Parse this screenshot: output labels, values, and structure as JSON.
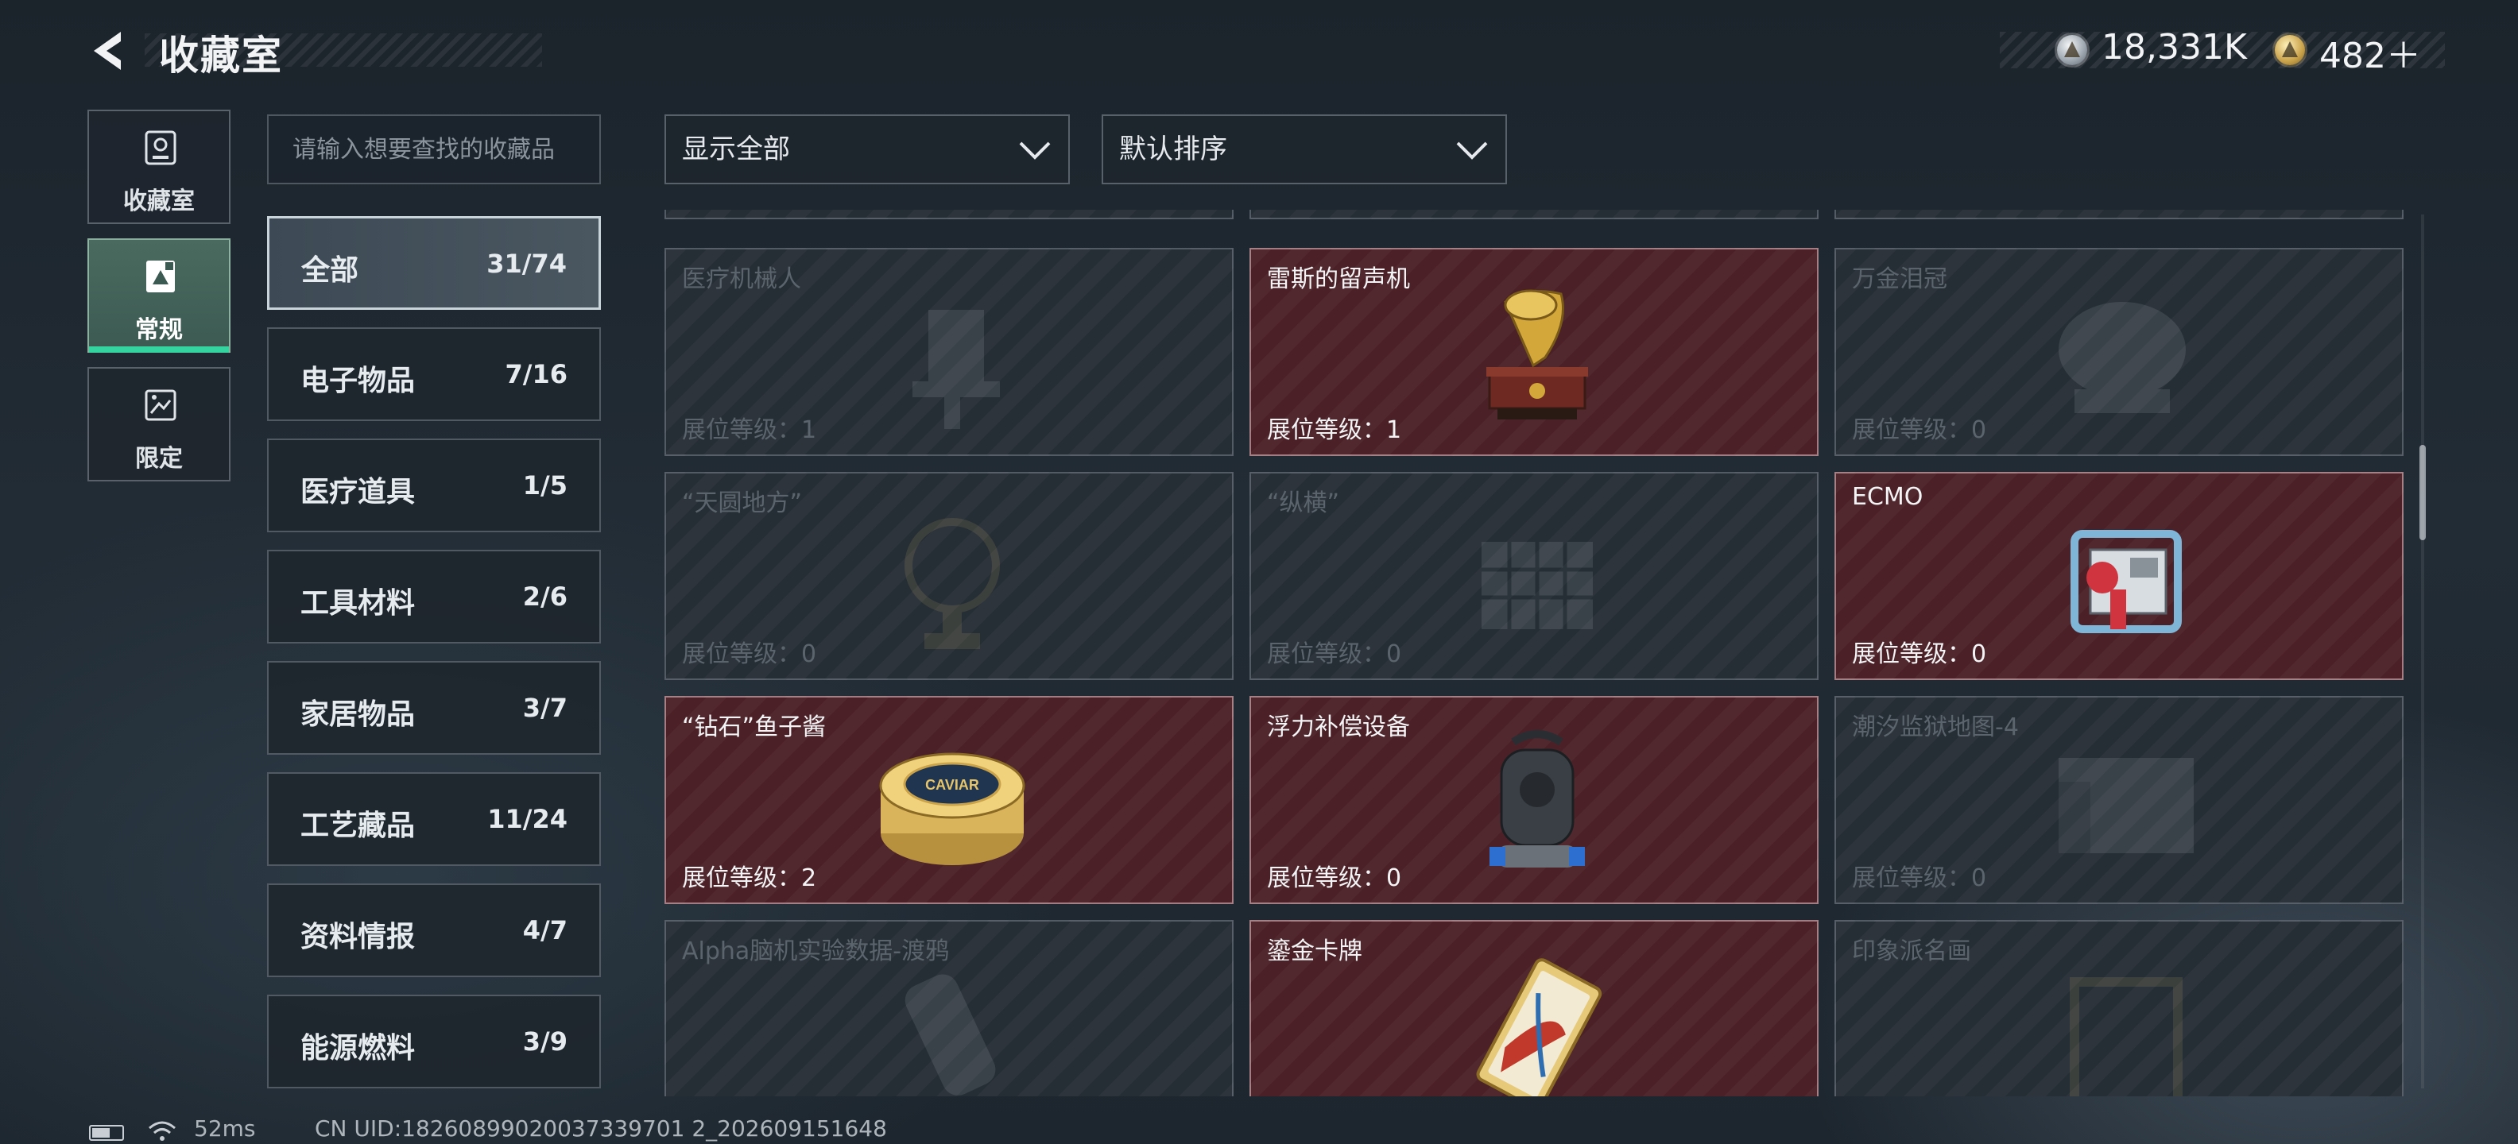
{
  "header": {
    "title": "收藏室",
    "currency_silver": "18,331K",
    "currency_gold": "482＋"
  },
  "nav": [
    {
      "label": "收藏室",
      "icon": "collection-room-icon"
    },
    {
      "label": "常规",
      "icon": "regular-icon",
      "active": true
    },
    {
      "label": "限定",
      "icon": "limited-icon"
    }
  ],
  "search": {
    "placeholder": "请输入想要查找的收藏品"
  },
  "filters": {
    "display": "显示全部",
    "sort": "默认排序"
  },
  "categories": [
    {
      "name": "全部",
      "count": "31/74"
    },
    {
      "name": "电子物品",
      "count": "7/16"
    },
    {
      "name": "医疗道具",
      "count": "1/5"
    },
    {
      "name": "工具材料",
      "count": "2/6"
    },
    {
      "name": "家居物品",
      "count": "3/7"
    },
    {
      "name": "工艺藏品",
      "count": "11/24"
    },
    {
      "name": "资料情报",
      "count": "4/7"
    },
    {
      "name": "能源燃料",
      "count": "3/9"
    }
  ],
  "items": [
    {
      "name": "医疗机械人",
      "level": "展位等级：1",
      "owned": false,
      "icon": "medical-robot-icon"
    },
    {
      "name": "雷斯的留声机",
      "level": "展位等级：1",
      "owned": true,
      "icon": "gramophone-icon"
    },
    {
      "name": "万金泪冠",
      "level": "展位等级：0",
      "owned": false,
      "icon": "tear-crown-icon"
    },
    {
      "name": "“天圆地方”",
      "level": "展位等级：0",
      "owned": false,
      "icon": "globe-trophy-icon"
    },
    {
      "name": "“纵横”",
      "level": "展位等级：0",
      "owned": false,
      "icon": "chessboard-icon"
    },
    {
      "name": "ECMO",
      "level": "展位等级：0",
      "owned": true,
      "icon": "ecmo-machine-icon"
    },
    {
      "name": "“钻石”鱼子酱",
      "level": "展位等级：2",
      "owned": true,
      "icon": "caviar-tin-icon",
      "art_text": "CAVIAR"
    },
    {
      "name": "浮力补偿设备",
      "level": "展位等级：0",
      "owned": true,
      "icon": "buoyancy-device-icon"
    },
    {
      "name": "潮汐监狱地图-4",
      "level": "展位等级：0",
      "owned": false,
      "icon": "prison-map-icon"
    },
    {
      "name": "Alpha脑机实验数据-渡鸦",
      "level": "",
      "owned": false,
      "icon": "data-device-icon"
    },
    {
      "name": "鎏金卡牌",
      "level": "",
      "owned": true,
      "icon": "gilded-card-icon"
    },
    {
      "name": "印象派名画",
      "level": "",
      "owned": false,
      "icon": "painting-icon"
    }
  ],
  "footer": {
    "ping": "52ms",
    "uid": "CN UID:18260899020037339701 2_202609151648"
  }
}
